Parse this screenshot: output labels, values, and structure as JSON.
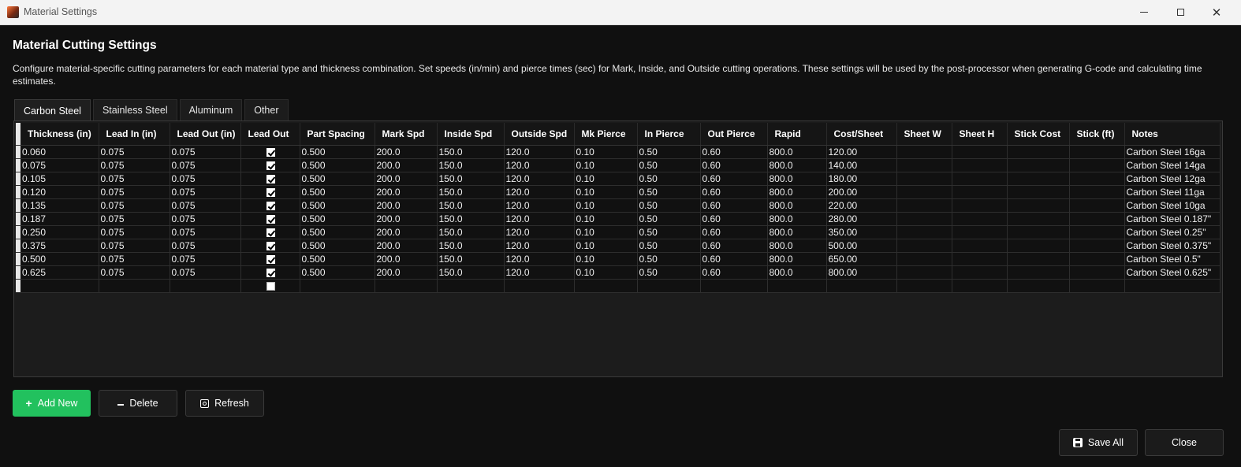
{
  "window": {
    "title": "Material Settings"
  },
  "header": {
    "title": "Material Cutting Settings",
    "description": "Configure material-specific cutting parameters for each material type and thickness combination. Set speeds (in/min) and pierce times (sec) for Mark, Inside, and Outside cutting operations. These settings will be used by the post-processor when generating G-code and calculating time estimates."
  },
  "tabs": [
    {
      "label": "Carbon Steel",
      "active": true
    },
    {
      "label": "Stainless Steel",
      "active": false
    },
    {
      "label": "Aluminum",
      "active": false
    },
    {
      "label": "Other",
      "active": false
    }
  ],
  "grid": {
    "columns": [
      "Thickness (in)",
      "Lead In (in)",
      "Lead Out (in)",
      "Lead Out",
      "Part Spacing",
      "Mark Spd",
      "Inside Spd",
      "Outside Spd",
      "Mk Pierce",
      "In Pierce",
      "Out Pierce",
      "Rapid",
      "Cost/Sheet",
      "Sheet W",
      "Sheet H",
      "Stick Cost",
      "Stick (ft)",
      "Notes"
    ],
    "rows": [
      {
        "thickness": "0.060",
        "lead_in": "0.075",
        "lead_out_in": "0.075",
        "lead_out": true,
        "part_spacing": "0.500",
        "mark_spd": "200.0",
        "inside_spd": "150.0",
        "outside_spd": "120.0",
        "mk_pierce": "0.10",
        "in_pierce": "0.50",
        "out_pierce": "0.60",
        "rapid": "800.0",
        "cost_sheet": "120.00",
        "sheet_w": "",
        "sheet_h": "",
        "stick_cost": "",
        "stick_ft": "",
        "notes": "Carbon Steel 16ga"
      },
      {
        "thickness": "0.075",
        "lead_in": "0.075",
        "lead_out_in": "0.075",
        "lead_out": true,
        "part_spacing": "0.500",
        "mark_spd": "200.0",
        "inside_spd": "150.0",
        "outside_spd": "120.0",
        "mk_pierce": "0.10",
        "in_pierce": "0.50",
        "out_pierce": "0.60",
        "rapid": "800.0",
        "cost_sheet": "140.00",
        "sheet_w": "",
        "sheet_h": "",
        "stick_cost": "",
        "stick_ft": "",
        "notes": "Carbon Steel 14ga"
      },
      {
        "thickness": "0.105",
        "lead_in": "0.075",
        "lead_out_in": "0.075",
        "lead_out": true,
        "part_spacing": "0.500",
        "mark_spd": "200.0",
        "inside_spd": "150.0",
        "outside_spd": "120.0",
        "mk_pierce": "0.10",
        "in_pierce": "0.50",
        "out_pierce": "0.60",
        "rapid": "800.0",
        "cost_sheet": "180.00",
        "sheet_w": "",
        "sheet_h": "",
        "stick_cost": "",
        "stick_ft": "",
        "notes": "Carbon Steel 12ga"
      },
      {
        "thickness": "0.120",
        "lead_in": "0.075",
        "lead_out_in": "0.075",
        "lead_out": true,
        "part_spacing": "0.500",
        "mark_spd": "200.0",
        "inside_spd": "150.0",
        "outside_spd": "120.0",
        "mk_pierce": "0.10",
        "in_pierce": "0.50",
        "out_pierce": "0.60",
        "rapid": "800.0",
        "cost_sheet": "200.00",
        "sheet_w": "",
        "sheet_h": "",
        "stick_cost": "",
        "stick_ft": "",
        "notes": "Carbon Steel 11ga"
      },
      {
        "thickness": "0.135",
        "lead_in": "0.075",
        "lead_out_in": "0.075",
        "lead_out": true,
        "part_spacing": "0.500",
        "mark_spd": "200.0",
        "inside_spd": "150.0",
        "outside_spd": "120.0",
        "mk_pierce": "0.10",
        "in_pierce": "0.50",
        "out_pierce": "0.60",
        "rapid": "800.0",
        "cost_sheet": "220.00",
        "sheet_w": "",
        "sheet_h": "",
        "stick_cost": "",
        "stick_ft": "",
        "notes": "Carbon Steel 10ga"
      },
      {
        "thickness": "0.187",
        "lead_in": "0.075",
        "lead_out_in": "0.075",
        "lead_out": true,
        "part_spacing": "0.500",
        "mark_spd": "200.0",
        "inside_spd": "150.0",
        "outside_spd": "120.0",
        "mk_pierce": "0.10",
        "in_pierce": "0.50",
        "out_pierce": "0.60",
        "rapid": "800.0",
        "cost_sheet": "280.00",
        "sheet_w": "",
        "sheet_h": "",
        "stick_cost": "",
        "stick_ft": "",
        "notes": "Carbon Steel 0.187\""
      },
      {
        "thickness": "0.250",
        "lead_in": "0.075",
        "lead_out_in": "0.075",
        "lead_out": true,
        "part_spacing": "0.500",
        "mark_spd": "200.0",
        "inside_spd": "150.0",
        "outside_spd": "120.0",
        "mk_pierce": "0.10",
        "in_pierce": "0.50",
        "out_pierce": "0.60",
        "rapid": "800.0",
        "cost_sheet": "350.00",
        "sheet_w": "",
        "sheet_h": "",
        "stick_cost": "",
        "stick_ft": "",
        "notes": "Carbon Steel 0.25\""
      },
      {
        "thickness": "0.375",
        "lead_in": "0.075",
        "lead_out_in": "0.075",
        "lead_out": true,
        "part_spacing": "0.500",
        "mark_spd": "200.0",
        "inside_spd": "150.0",
        "outside_spd": "120.0",
        "mk_pierce": "0.10",
        "in_pierce": "0.50",
        "out_pierce": "0.60",
        "rapid": "800.0",
        "cost_sheet": "500.00",
        "sheet_w": "",
        "sheet_h": "",
        "stick_cost": "",
        "stick_ft": "",
        "notes": "Carbon Steel 0.375\""
      },
      {
        "thickness": "0.500",
        "lead_in": "0.075",
        "lead_out_in": "0.075",
        "lead_out": true,
        "part_spacing": "0.500",
        "mark_spd": "200.0",
        "inside_spd": "150.0",
        "outside_spd": "120.0",
        "mk_pierce": "0.10",
        "in_pierce": "0.50",
        "out_pierce": "0.60",
        "rapid": "800.0",
        "cost_sheet": "650.00",
        "sheet_w": "",
        "sheet_h": "",
        "stick_cost": "",
        "stick_ft": "",
        "notes": "Carbon Steel 0.5\""
      },
      {
        "thickness": "0.625",
        "lead_in": "0.075",
        "lead_out_in": "0.075",
        "lead_out": true,
        "part_spacing": "0.500",
        "mark_spd": "200.0",
        "inside_spd": "150.0",
        "outside_spd": "120.0",
        "mk_pierce": "0.10",
        "in_pierce": "0.50",
        "out_pierce": "0.60",
        "rapid": "800.0",
        "cost_sheet": "800.00",
        "sheet_w": "",
        "sheet_h": "",
        "stick_cost": "",
        "stick_ft": "",
        "notes": "Carbon Steel 0.625\""
      },
      {
        "thickness": "",
        "lead_in": "",
        "lead_out_in": "",
        "lead_out": false,
        "part_spacing": "",
        "mark_spd": "",
        "inside_spd": "",
        "outside_spd": "",
        "mk_pierce": "",
        "in_pierce": "",
        "out_pierce": "",
        "rapid": "",
        "cost_sheet": "",
        "sheet_w": "",
        "sheet_h": "",
        "stick_cost": "",
        "stick_ft": "",
        "notes": ""
      }
    ]
  },
  "buttons": {
    "add_new": "Add New",
    "delete": "Delete",
    "refresh": "Refresh",
    "save_all": "Save All",
    "close": "Close"
  },
  "colors": {
    "accent_green": "#22c15e",
    "background": "#101010"
  }
}
